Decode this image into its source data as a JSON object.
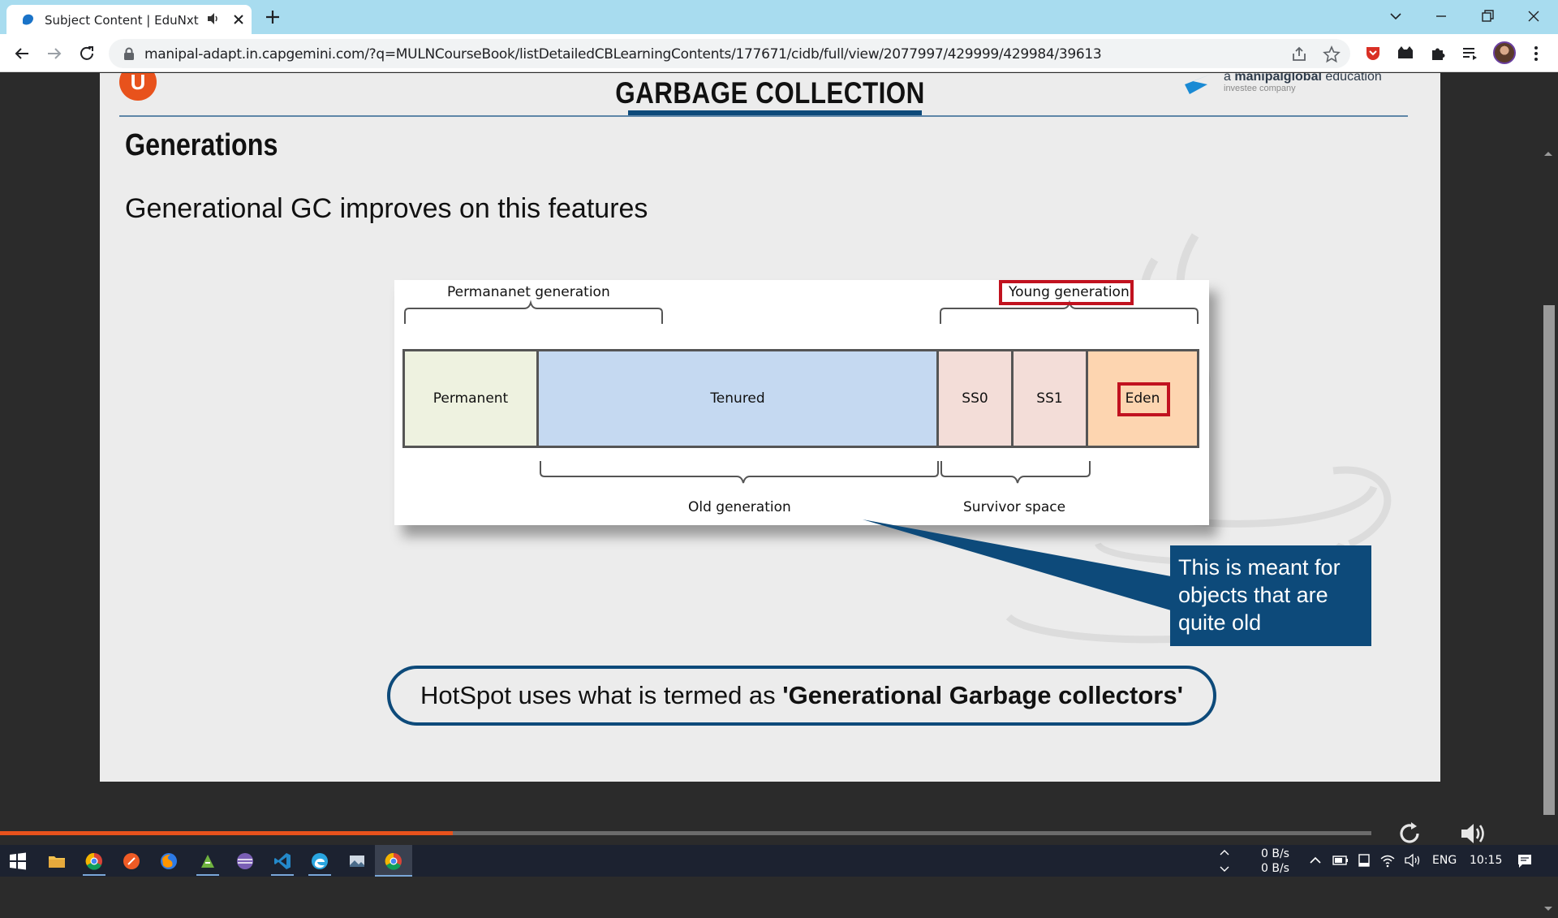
{
  "browser": {
    "tab_title": "Subject Content | EduNxt",
    "url": "manipal-adapt.in.capgemini.com/?q=MULNCourseBook/listDetailedCBLearningContents/177671/cidb/full/view/2077997/429999/429984/39613"
  },
  "slide": {
    "title": "GARBAGE COLLECTION",
    "brand_letter": "U",
    "partner_prefix": "a ",
    "partner_brand": "manipalglobal",
    "partner_suffix": " education",
    "partner_sub": "investee company",
    "heading": "Generations",
    "subtext": "Generational GC improves on this features",
    "diagram": {
      "permanent_generation_label": "Permananet generation",
      "young_generation_label": "Young generation",
      "segments": [
        "Permanent",
        "Tenured",
        "SS0",
        "SS1",
        "Eden"
      ],
      "old_generation_label": "Old generation",
      "survivor_space_label": "Survivor space"
    },
    "callout": "This is meant for objects that are quite old",
    "footer_prefix": "HotSpot uses what is termed as ",
    "footer_bold": "'Generational Garbage collectors'"
  },
  "player": {
    "progress": 0.33
  },
  "taskbar": {
    "net_up": "0 B/s",
    "net_down": "0 B/s",
    "language": "ENG",
    "time": "10:15"
  },
  "colors": {
    "accent_orange": "#e8521c",
    "brand_blue": "#0d4a7a",
    "highlight_red": "#c1121f",
    "permanent_fill": "#eef2e0",
    "tenured_fill": "#c5d9f1",
    "survivor_fill": "#f3ddd8",
    "eden_fill": "#fdd5b0"
  }
}
